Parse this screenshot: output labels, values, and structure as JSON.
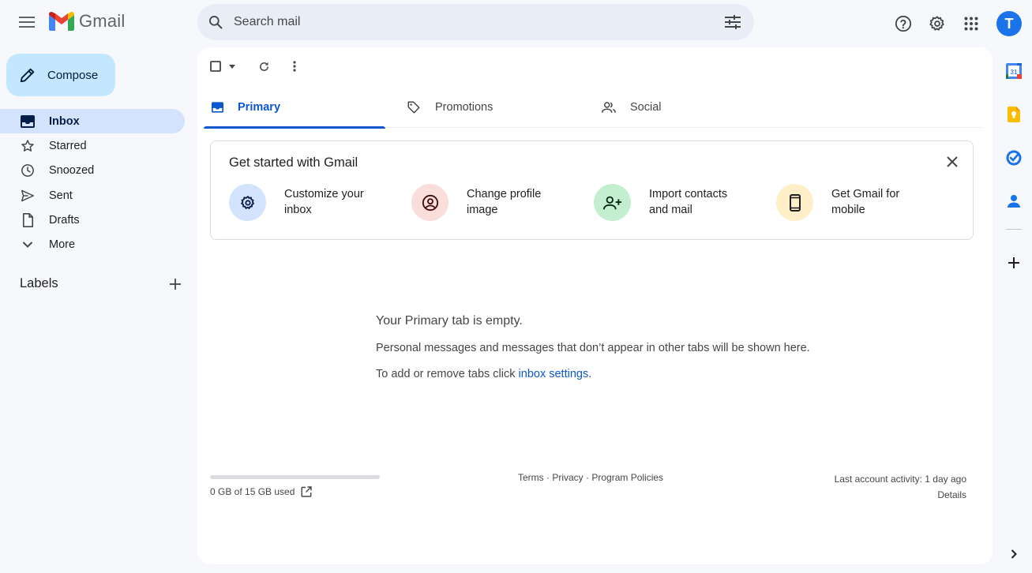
{
  "app": {
    "name": "Gmail",
    "brand_colors": {
      "red": "#EA4335",
      "blue": "#4285F4",
      "green": "#34A853",
      "yellow": "#FBBC04",
      "dark_red": "#C5221F"
    }
  },
  "header": {
    "search_placeholder": "Search mail",
    "avatar_letter": "T",
    "icons": [
      "hamburger-icon",
      "search-icon",
      "tune-icon",
      "help-icon",
      "gear-icon",
      "apps-grid-icon"
    ]
  },
  "sidebar": {
    "compose_label": "Compose",
    "items": [
      {
        "label": "Inbox",
        "icon": "inbox-icon",
        "active": true
      },
      {
        "label": "Starred",
        "icon": "star-icon",
        "active": false
      },
      {
        "label": "Snoozed",
        "icon": "clock-icon",
        "active": false
      },
      {
        "label": "Sent",
        "icon": "send-icon",
        "active": false
      },
      {
        "label": "Drafts",
        "icon": "draft-icon",
        "active": false
      },
      {
        "label": "More",
        "icon": "chevron-down-icon",
        "active": false
      }
    ],
    "labels_title": "Labels"
  },
  "tabs": [
    {
      "label": "Primary",
      "icon": "inbox-icon",
      "active": true
    },
    {
      "label": "Promotions",
      "icon": "tag-icon",
      "active": false
    },
    {
      "label": "Social",
      "icon": "people-icon",
      "active": false
    }
  ],
  "get_started": {
    "title": "Get started with Gmail",
    "items": [
      {
        "line1": "Customize your",
        "line2": "inbox",
        "icon": "gear-icon",
        "bg": "#d3e3fd"
      },
      {
        "line1": "Change profile",
        "line2": "image",
        "icon": "account-circle-icon",
        "bg": "#f9dedc"
      },
      {
        "line1": "Import contacts",
        "line2": "and mail",
        "icon": "person-add-icon",
        "bg": "#c4eed0"
      },
      {
        "line1": "Get Gmail for",
        "line2": "mobile",
        "icon": "smartphone-icon",
        "bg": "#ffefc9"
      }
    ]
  },
  "empty_state": {
    "title": "Your Primary tab is empty.",
    "description": "Personal messages and messages that don’t appear in other tabs will be shown here.",
    "hint_prefix": "To add or remove tabs click ",
    "hint_link": "inbox settings",
    "hint_suffix": "."
  },
  "footer": {
    "storage_text": "0 GB of 15 GB used",
    "storage_used_fraction": 0,
    "links": [
      "Terms",
      "Privacy",
      "Program Policies"
    ],
    "separator": " · ",
    "activity": "Last account activity: 1 day ago",
    "details": "Details"
  },
  "side_panel": {
    "icons": [
      "calendar-icon",
      "keep-icon",
      "tasks-icon",
      "contacts-icon",
      "add-icon"
    ],
    "calendar_day": "31"
  }
}
